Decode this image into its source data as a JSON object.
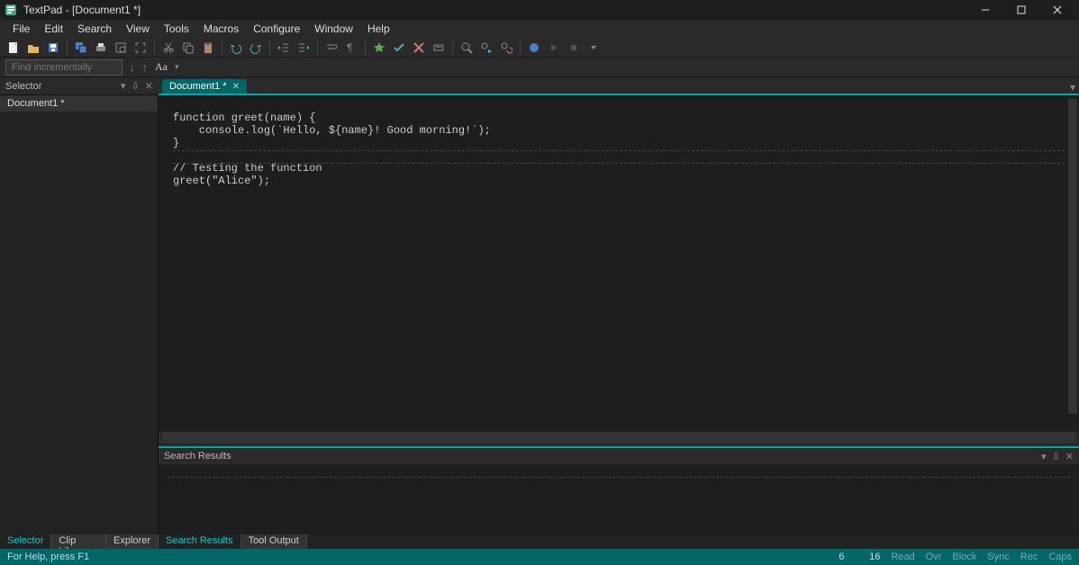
{
  "app": {
    "title": "TextPad - [Document1 *]"
  },
  "menu": [
    "File",
    "Edit",
    "Search",
    "View",
    "Tools",
    "Macros",
    "Configure",
    "Window",
    "Help"
  ],
  "find": {
    "placeholder": "Find incrementally",
    "aa": "Aa"
  },
  "selector": {
    "title": "Selector",
    "doc": "Document1 *"
  },
  "tab": {
    "label": "Document1 *"
  },
  "code": {
    "l1": "function greet(name) {",
    "l2": "    console.log(`Hello, ${name}! Good morning!`);",
    "l3": "}",
    "l4": "",
    "l5": "// Testing the function",
    "l6": "greet(\"Alice\");"
  },
  "search_results": {
    "title": "Search Results"
  },
  "bottom_panels": {
    "search": "Search Results",
    "tool": "Tool Output"
  },
  "side_tabs": {
    "selector": "Selector",
    "clip": "Clip Library",
    "explorer": "Explorer"
  },
  "status": {
    "help": "For Help, press F1",
    "line": "6",
    "col": "16",
    "read": "Read",
    "ovr": "Ovr",
    "block": "Block",
    "sync": "Sync",
    "rec": "Rec",
    "caps": "Caps"
  }
}
